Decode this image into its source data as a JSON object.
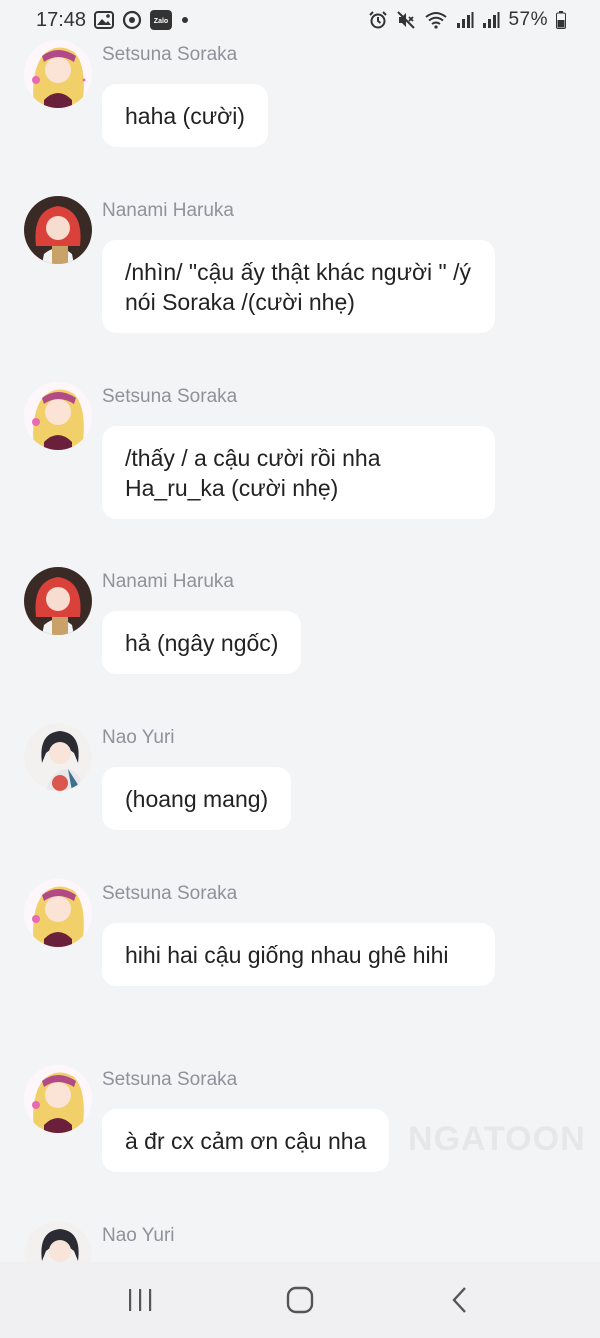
{
  "status": {
    "time": "17:48",
    "battery": "57%",
    "icons_left": [
      "gallery-icon",
      "messenger-icon",
      "zalo-icon",
      "dot-icon"
    ],
    "zalo_label": "Zalo",
    "icons_right": [
      "alarm-icon",
      "mute-icon",
      "wifi-icon",
      "signal-icon",
      "signal-icon",
      "battery-icon"
    ]
  },
  "messages": [
    {
      "sender": "Setsuna Soraka",
      "text": "haha (cười)",
      "avatar": "setsuna-avatar"
    },
    {
      "sender": "Nanami Haruka",
      "text": "/nhìn/ \"cậu ấy thật khác người \" /ý nói Soraka /(cười nhẹ)",
      "avatar": "nanami-avatar"
    },
    {
      "sender": "Setsuna Soraka",
      "text": "/thấy / a cậu cười rồi nha Ha_ru_ka (cười nhẹ)",
      "avatar": "setsuna-avatar"
    },
    {
      "sender": "Nanami Haruka",
      "text": "hả (ngây ngốc)",
      "avatar": "nanami-avatar"
    },
    {
      "sender": "Nao Yuri",
      "text": "(hoang mang)",
      "avatar": "nao-avatar"
    },
    {
      "sender": "Setsuna Soraka",
      "text": "hihi hai cậu giống nhau ghê hihi",
      "avatar": "setsuna-avatar"
    },
    {
      "sender": "Setsuna Soraka",
      "text": "à đr cx cảm ơn cậu nha",
      "avatar": "setsuna-avatar"
    },
    {
      "sender": "Nao Yuri",
      "text": "",
      "avatar": "nao-avatar"
    }
  ],
  "watermark": "NGATOON",
  "nav": {
    "recents": "recents-icon",
    "home": "home-icon",
    "back": "back-icon"
  },
  "colors": {
    "background": "#f3f4f6",
    "bubble": "#ffffff",
    "sender": "#8e9299",
    "text": "#222222"
  }
}
